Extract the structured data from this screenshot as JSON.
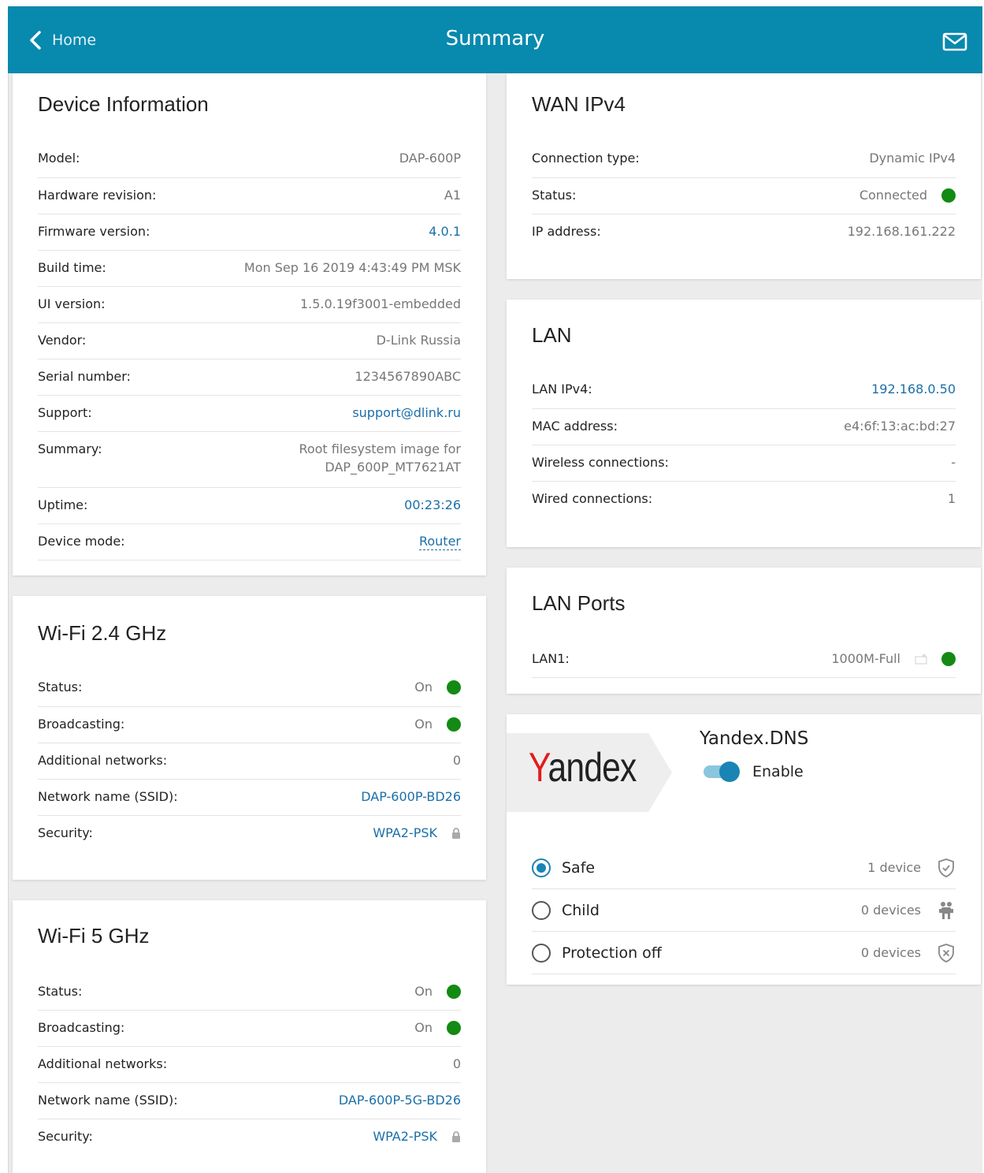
{
  "header": {
    "back_label": "Home",
    "title": "Summary"
  },
  "device_info": {
    "title": "Device Information",
    "rows": [
      {
        "label": "Model:",
        "value": "DAP-600P"
      },
      {
        "label": "Hardware revision:",
        "value": "A1"
      },
      {
        "label": "Firmware version:",
        "value": "4.0.1"
      },
      {
        "label": "Build time:",
        "value": "Mon Sep 16 2019 4:43:49 PM MSK"
      },
      {
        "label": "UI version:",
        "value": "1.5.0.19f3001-embedded"
      },
      {
        "label": "Vendor:",
        "value": "D-Link Russia"
      },
      {
        "label": "Serial number:",
        "value": "1234567890ABC"
      },
      {
        "label": "Support:",
        "value": "support@dlink.ru"
      },
      {
        "label": "Summary:",
        "value_line1": "Root filesystem image for",
        "value_line2": "DAP_600P_MT7621AT"
      },
      {
        "label": "Uptime:",
        "value": "00:23:26"
      },
      {
        "label": "Device mode:",
        "value": "Router"
      }
    ]
  },
  "wifi24": {
    "title": "Wi-Fi 2.4 GHz",
    "rows": [
      {
        "label": "Status:",
        "value": "On"
      },
      {
        "label": "Broadcasting:",
        "value": "On"
      },
      {
        "label": "Additional networks:",
        "value": "0"
      },
      {
        "label": "Network name (SSID):",
        "value": "DAP-600P-BD26"
      },
      {
        "label": "Security:",
        "value": "WPA2-PSK"
      }
    ]
  },
  "wifi5": {
    "title": "Wi-Fi 5 GHz",
    "rows": [
      {
        "label": "Status:",
        "value": "On"
      },
      {
        "label": "Broadcasting:",
        "value": "On"
      },
      {
        "label": "Additional networks:",
        "value": "0"
      },
      {
        "label": "Network name (SSID):",
        "value": "DAP-600P-5G-BD26"
      },
      {
        "label": "Security:",
        "value": "WPA2-PSK"
      }
    ]
  },
  "wan": {
    "title": "WAN IPv4",
    "rows": [
      {
        "label": "Connection type:",
        "value": "Dynamic IPv4"
      },
      {
        "label": "Status:",
        "value": "Connected"
      },
      {
        "label": "IP address:",
        "value": "192.168.161.222"
      }
    ]
  },
  "lan": {
    "title": "LAN",
    "rows": [
      {
        "label": "LAN IPv4:",
        "value": "192.168.0.50"
      },
      {
        "label": "MAC address:",
        "value": "e4:6f:13:ac:bd:27"
      },
      {
        "label": "Wireless connections:",
        "value": "-"
      },
      {
        "label": "Wired connections:",
        "value": "1"
      }
    ]
  },
  "lan_ports": {
    "title": "LAN Ports",
    "rows": [
      {
        "label": "LAN1:",
        "value": "1000M-Full"
      }
    ]
  },
  "yandex": {
    "logo_text_first": "Y",
    "logo_text_rest": "andex",
    "title": "Yandex.DNS",
    "enable_label": "Enable",
    "options": [
      {
        "name": "Safe",
        "count": "1 device",
        "icon": "shield-check-icon",
        "selected": true
      },
      {
        "name": "Child",
        "count": "0 devices",
        "icon": "child-icon",
        "selected": false
      },
      {
        "name": "Protection off",
        "count": "0 devices",
        "icon": "shield-x-icon",
        "selected": false
      }
    ]
  },
  "colors": {
    "header": "#0889ae",
    "status_green": "#138a13",
    "link": "#1b6fa8"
  }
}
